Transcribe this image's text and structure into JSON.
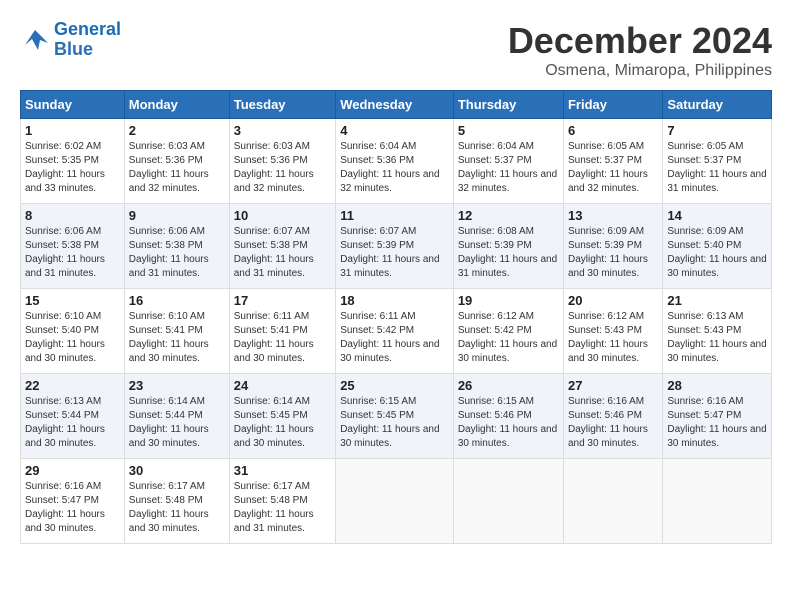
{
  "logo": {
    "line1": "General",
    "line2": "Blue"
  },
  "title": "December 2024",
  "subtitle": "Osmena, Mimaropa, Philippines",
  "weekdays": [
    "Sunday",
    "Monday",
    "Tuesday",
    "Wednesday",
    "Thursday",
    "Friday",
    "Saturday"
  ],
  "weeks": [
    [
      {
        "day": 1,
        "sunrise": "6:02 AM",
        "sunset": "5:35 PM",
        "daylight": "11 hours and 33 minutes."
      },
      {
        "day": 2,
        "sunrise": "6:03 AM",
        "sunset": "5:36 PM",
        "daylight": "11 hours and 32 minutes."
      },
      {
        "day": 3,
        "sunrise": "6:03 AM",
        "sunset": "5:36 PM",
        "daylight": "11 hours and 32 minutes."
      },
      {
        "day": 4,
        "sunrise": "6:04 AM",
        "sunset": "5:36 PM",
        "daylight": "11 hours and 32 minutes."
      },
      {
        "day": 5,
        "sunrise": "6:04 AM",
        "sunset": "5:37 PM",
        "daylight": "11 hours and 32 minutes."
      },
      {
        "day": 6,
        "sunrise": "6:05 AM",
        "sunset": "5:37 PM",
        "daylight": "11 hours and 32 minutes."
      },
      {
        "day": 7,
        "sunrise": "6:05 AM",
        "sunset": "5:37 PM",
        "daylight": "11 hours and 31 minutes."
      }
    ],
    [
      {
        "day": 8,
        "sunrise": "6:06 AM",
        "sunset": "5:38 PM",
        "daylight": "11 hours and 31 minutes."
      },
      {
        "day": 9,
        "sunrise": "6:06 AM",
        "sunset": "5:38 PM",
        "daylight": "11 hours and 31 minutes."
      },
      {
        "day": 10,
        "sunrise": "6:07 AM",
        "sunset": "5:38 PM",
        "daylight": "11 hours and 31 minutes."
      },
      {
        "day": 11,
        "sunrise": "6:07 AM",
        "sunset": "5:39 PM",
        "daylight": "11 hours and 31 minutes."
      },
      {
        "day": 12,
        "sunrise": "6:08 AM",
        "sunset": "5:39 PM",
        "daylight": "11 hours and 31 minutes."
      },
      {
        "day": 13,
        "sunrise": "6:09 AM",
        "sunset": "5:39 PM",
        "daylight": "11 hours and 30 minutes."
      },
      {
        "day": 14,
        "sunrise": "6:09 AM",
        "sunset": "5:40 PM",
        "daylight": "11 hours and 30 minutes."
      }
    ],
    [
      {
        "day": 15,
        "sunrise": "6:10 AM",
        "sunset": "5:40 PM",
        "daylight": "11 hours and 30 minutes."
      },
      {
        "day": 16,
        "sunrise": "6:10 AM",
        "sunset": "5:41 PM",
        "daylight": "11 hours and 30 minutes."
      },
      {
        "day": 17,
        "sunrise": "6:11 AM",
        "sunset": "5:41 PM",
        "daylight": "11 hours and 30 minutes."
      },
      {
        "day": 18,
        "sunrise": "6:11 AM",
        "sunset": "5:42 PM",
        "daylight": "11 hours and 30 minutes."
      },
      {
        "day": 19,
        "sunrise": "6:12 AM",
        "sunset": "5:42 PM",
        "daylight": "11 hours and 30 minutes."
      },
      {
        "day": 20,
        "sunrise": "6:12 AM",
        "sunset": "5:43 PM",
        "daylight": "11 hours and 30 minutes."
      },
      {
        "day": 21,
        "sunrise": "6:13 AM",
        "sunset": "5:43 PM",
        "daylight": "11 hours and 30 minutes."
      }
    ],
    [
      {
        "day": 22,
        "sunrise": "6:13 AM",
        "sunset": "5:44 PM",
        "daylight": "11 hours and 30 minutes."
      },
      {
        "day": 23,
        "sunrise": "6:14 AM",
        "sunset": "5:44 PM",
        "daylight": "11 hours and 30 minutes."
      },
      {
        "day": 24,
        "sunrise": "6:14 AM",
        "sunset": "5:45 PM",
        "daylight": "11 hours and 30 minutes."
      },
      {
        "day": 25,
        "sunrise": "6:15 AM",
        "sunset": "5:45 PM",
        "daylight": "11 hours and 30 minutes."
      },
      {
        "day": 26,
        "sunrise": "6:15 AM",
        "sunset": "5:46 PM",
        "daylight": "11 hours and 30 minutes."
      },
      {
        "day": 27,
        "sunrise": "6:16 AM",
        "sunset": "5:46 PM",
        "daylight": "11 hours and 30 minutes."
      },
      {
        "day": 28,
        "sunrise": "6:16 AM",
        "sunset": "5:47 PM",
        "daylight": "11 hours and 30 minutes."
      }
    ],
    [
      {
        "day": 29,
        "sunrise": "6:16 AM",
        "sunset": "5:47 PM",
        "daylight": "11 hours and 30 minutes."
      },
      {
        "day": 30,
        "sunrise": "6:17 AM",
        "sunset": "5:48 PM",
        "daylight": "11 hours and 30 minutes."
      },
      {
        "day": 31,
        "sunrise": "6:17 AM",
        "sunset": "5:48 PM",
        "daylight": "11 hours and 31 minutes."
      },
      null,
      null,
      null,
      null
    ]
  ]
}
